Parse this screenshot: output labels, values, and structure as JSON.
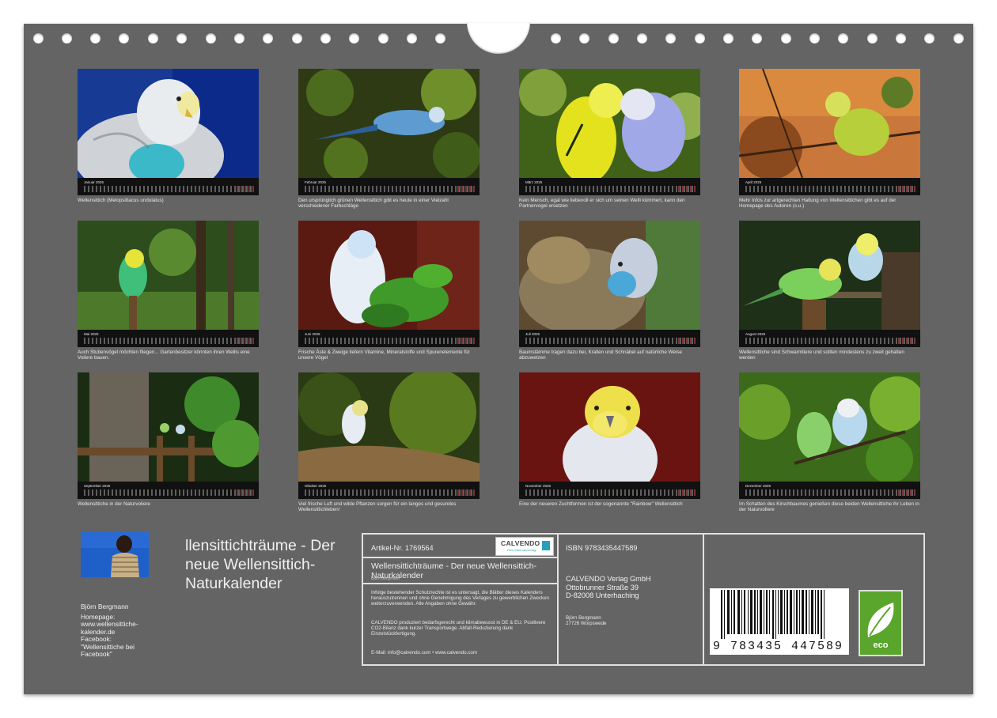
{
  "months": [
    {
      "name": "Januar",
      "caption": "Wellensittich (Melopsittacus undulatus)"
    },
    {
      "name": "Februar",
      "caption": "Den ursprünglich grünen Wellensittich gibt es heute in einer Vielzahl verschiedener Farbschläge"
    },
    {
      "name": "März",
      "caption": "Kein Mensch, egal wie liebevoll er sich um seinen Welli kümmert, kann den Partnervogel ersetzen"
    },
    {
      "name": "April",
      "caption": "Mehr Infos zur artgerechten Haltung von Wellensittichen gibt es auf der Homepage des Autoren (s.u.)"
    },
    {
      "name": "Mai",
      "caption": "Auch Stubenvögel möchten fliegen... Gartenbesitzer könnten ihren Wellis eine Voliere bauen."
    },
    {
      "name": "Juni",
      "caption": "Frische Äste & Zweige liefern Vitamine, Mineralstoffe und Spurenelemente für unsere Vögel"
    },
    {
      "name": "Juli",
      "caption": "Baumstämme tragen dazu bei, Krallen und Schnäbel auf natürliche Weise abzuwetzen"
    },
    {
      "name": "August",
      "caption": "Wellensittiche sind Schwarmtiere und sollten mindestens zu zweit gehalten werden"
    },
    {
      "name": "September",
      "caption": "Wellensittiche in der Naturvoliere"
    },
    {
      "name": "Oktober",
      "caption": "Viel frische Luft und wilde Pflanzen sorgen für ein langes und gesundes Wellensittichleben!"
    },
    {
      "name": "November",
      "caption": "Eine der neueren Zuchtformen ist der sogenannte \"Rainbow\" Wellensittich"
    },
    {
      "name": "Dezember",
      "caption": "Im Schatten des Kirschbaumes genießen diese beiden Wellensittiche ihr Leben in der Naturvoliere"
    }
  ],
  "year": "2025",
  "footer": {
    "title": "llensittichträume - Der neue Wellensittich-Naturkalender",
    "author": "Björn Bergmann",
    "homepage_label": "Homepage:",
    "homepage": "www.wellensittiche-kalender.de",
    "facebook_label": "Facebook:",
    "facebook": "\"Wellensittiche bei Facebook\""
  },
  "info": {
    "artikel": "Artikel-Nr. 1769564",
    "logo_brand": "CALVENDO",
    "logo_sub": "Dein Kalenderverlag",
    "product_title": "Wellensittichträume - Der neue Wellensittich-Naturkalender",
    "product_author": "Björn Bergmann",
    "legal1": "Infolge bestehender Schutzrechte ist es untersagt, die Blätter dieses Kalenders herauszutrennen und ohne Genehmigung des Verlages zu gewerblichen Zwecken weiterzuverwenden. Alle Angaben ohne Gewähr.",
    "legal2": "CALVENDO produziert bedarfsgerecht und klimabewusst in DE & EU. Positivere CO2-Bilanz dank kurzer Transportwege. Abfall-Reduzierung dank Einzelstückfertigung.",
    "contact": "E-Mail: info@calvendo.com • www.calvendo.com",
    "isbn": "ISBN 9783435447589",
    "verlag_line1": "CALVENDO Verlag GmbH",
    "verlag_line2": "Ottobrunner Straße 39",
    "verlag_line3": "D-82008 Unterhaching",
    "credit_line1": "Björn Bergmann",
    "credit_line2": "27726 Worpswede",
    "barcode_number": "9 783435 447589",
    "eco_label": "eco"
  },
  "colors": {
    "board": "#646464",
    "leaf_green": "#5aa52b"
  }
}
